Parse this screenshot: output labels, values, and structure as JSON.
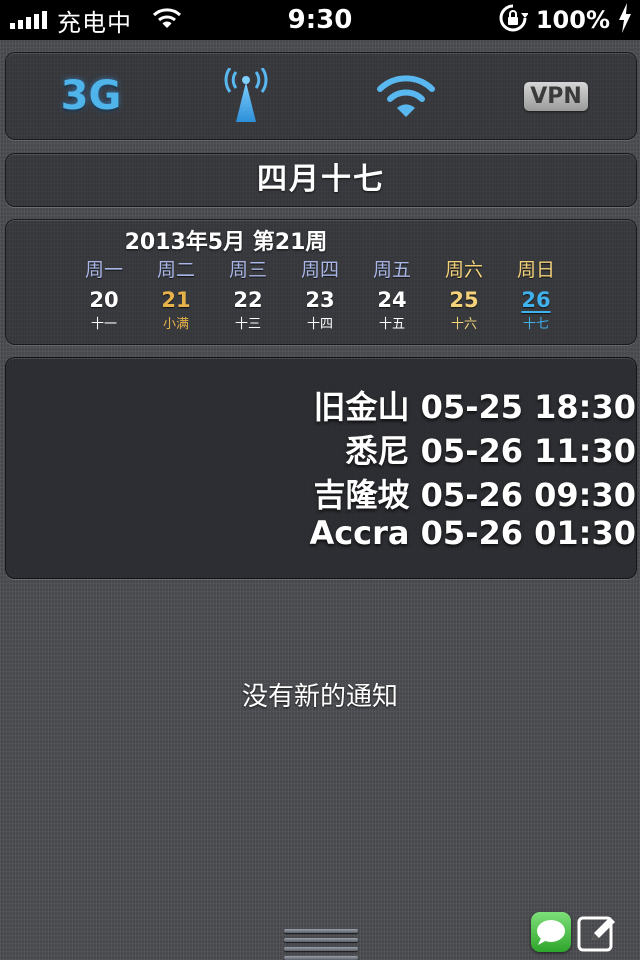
{
  "status_bar": {
    "carrier": "充电中",
    "time": "9:30",
    "battery": "100%"
  },
  "toggles": {
    "network_label": "3G",
    "vpn_label": "VPN"
  },
  "lunar_date": "四月十七",
  "calendar": {
    "title": "2013年5月 第21周",
    "days": [
      {
        "weekday": "周一",
        "date": "20",
        "lunar": "十一",
        "color": "#ffffff",
        "weekday_color": "#a9b6e6"
      },
      {
        "weekday": "周二",
        "date": "21",
        "lunar": "小满",
        "color": "#e7b24a",
        "weekday_color": "#a9b6e6"
      },
      {
        "weekday": "周三",
        "date": "22",
        "lunar": "十三",
        "color": "#ffffff",
        "weekday_color": "#a9b6e6"
      },
      {
        "weekday": "周四",
        "date": "23",
        "lunar": "十四",
        "color": "#ffffff",
        "weekday_color": "#a9b6e6"
      },
      {
        "weekday": "周五",
        "date": "24",
        "lunar": "十五",
        "color": "#ffffff",
        "weekday_color": "#a9b6e6"
      },
      {
        "weekday": "周六",
        "date": "25",
        "lunar": "十六",
        "color": "#f3d27a",
        "weekday_color": "#f3d27a"
      },
      {
        "weekday": "周日",
        "date": "26",
        "lunar": "十七",
        "color": "#3fb2ee",
        "weekday_color": "#f3d27a"
      }
    ]
  },
  "world_clock": [
    {
      "city": "旧金山",
      "time": "05-25 18:30"
    },
    {
      "city": "悉尼",
      "time": "05-26 11:30"
    },
    {
      "city": "吉隆坡",
      "time": "05-26 09:30"
    },
    {
      "city": "Accra",
      "time": "05-26 01:30"
    }
  ],
  "no_notifications": "没有新的通知",
  "colors": {
    "accent_blue": "#4fb4ea",
    "message_green": "#2ea52b"
  },
  "icons": {
    "cellular": "antenna-icon",
    "wifi": "wifi-icon",
    "message": "message-icon",
    "compose": "compose-icon"
  }
}
